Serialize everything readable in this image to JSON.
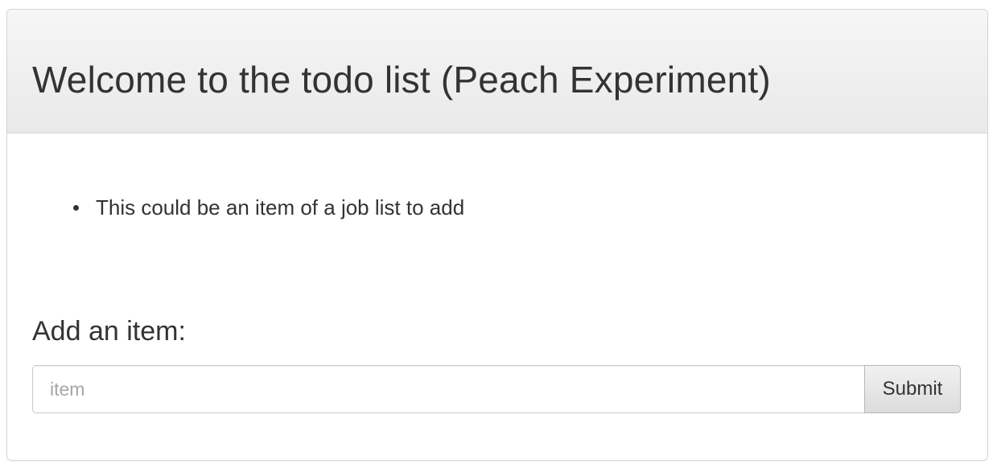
{
  "panel": {
    "title": "Welcome to the todo list (Peach Experiment)"
  },
  "todo": {
    "items": [
      {
        "text": "This could be an item of a job list to add"
      }
    ]
  },
  "add_form": {
    "heading": "Add an item:",
    "input_placeholder": "item",
    "input_value": "",
    "submit_label": "Submit"
  }
}
